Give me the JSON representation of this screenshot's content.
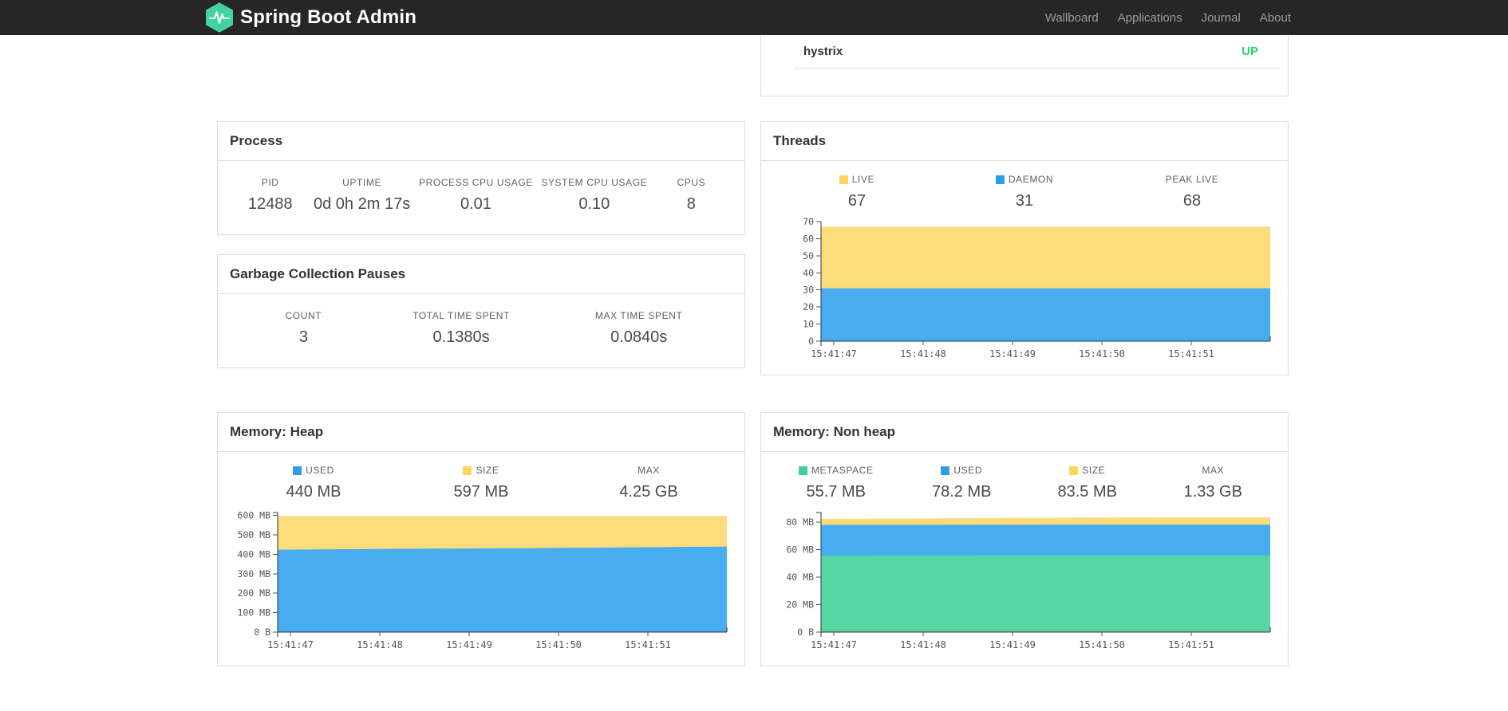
{
  "navbar": {
    "brand": "Spring Boot Admin",
    "links": [
      {
        "label": "Wallboard"
      },
      {
        "label": "Applications"
      },
      {
        "label": "Journal"
      },
      {
        "label": "About"
      }
    ],
    "colors": {
      "background": "#262626",
      "link": "#9d9d9d",
      "logo_green": "#42d3a5"
    }
  },
  "application_row": {
    "name": "hystrix",
    "status": "UP",
    "status_color": "#2bd46e"
  },
  "cards": {
    "process": {
      "title": "Process",
      "stats": [
        {
          "label": "PID",
          "value": "12488"
        },
        {
          "label": "UPTIME",
          "value": "0d 0h 2m 17s"
        },
        {
          "label": "PROCESS CPU USAGE",
          "value": "0.01"
        },
        {
          "label": "SYSTEM CPU USAGE",
          "value": "0.10"
        },
        {
          "label": "CPUS",
          "value": "8"
        }
      ]
    },
    "gc": {
      "title": "Garbage Collection Pauses",
      "stats": [
        {
          "label": "COUNT",
          "value": "3"
        },
        {
          "label": "TOTAL TIME SPENT",
          "value": "0.1380s"
        },
        {
          "label": "MAX TIME SPENT",
          "value": "0.0840s"
        }
      ]
    },
    "threads": {
      "title": "Threads",
      "stats": [
        {
          "label": "LIVE",
          "value": "67",
          "swatch": "#fcd45e"
        },
        {
          "label": "DAEMON",
          "value": "31",
          "swatch": "#2e9ee8"
        },
        {
          "label": "PEAK LIVE",
          "value": "68",
          "swatch": ""
        }
      ]
    },
    "heap": {
      "title": "Memory: Heap",
      "stats": [
        {
          "label": "USED",
          "value": "440 MB",
          "swatch": "#2e9ee8"
        },
        {
          "label": "SIZE",
          "value": "597 MB",
          "swatch": "#fcd45e"
        },
        {
          "label": "MAX",
          "value": "4.25 GB",
          "swatch": ""
        }
      ]
    },
    "nonheap": {
      "title": "Memory: Non heap",
      "stats": [
        {
          "label": "METASPACE",
          "value": "55.7 MB",
          "swatch": "#3fd1a1"
        },
        {
          "label": "USED",
          "value": "78.2 MB",
          "swatch": "#2e9ee8"
        },
        {
          "label": "SIZE",
          "value": "83.5 MB",
          "swatch": "#fcd45e"
        },
        {
          "label": "MAX",
          "value": "1.33 GB",
          "swatch": ""
        }
      ]
    }
  },
  "chart_data": [
    {
      "id": "threads",
      "type": "area",
      "title": "Threads",
      "x": [
        "15:41:47",
        "15:41:48",
        "15:41:49",
        "15:41:50",
        "15:41:51"
      ],
      "series": [
        {
          "name": "LIVE",
          "color": "#fddd7b",
          "values": [
            67,
            67,
            67,
            67,
            67
          ]
        },
        {
          "name": "DAEMON",
          "color": "#48acf0",
          "values": [
            31,
            31,
            31,
            31,
            31
          ]
        }
      ],
      "ylim": [
        0,
        70
      ],
      "yticks": [
        {
          "v": 0,
          "label": "0"
        },
        {
          "v": 10,
          "label": "10"
        },
        {
          "v": 20,
          "label": "20"
        },
        {
          "v": 30,
          "label": "30"
        },
        {
          "v": 40,
          "label": "40"
        },
        {
          "v": 50,
          "label": "50"
        },
        {
          "v": 60,
          "label": "60"
        },
        {
          "v": 70,
          "label": "70"
        }
      ],
      "grid": false,
      "legend_position": "top",
      "note": "layered absolute areas; LIVE drawn behind DAEMON"
    },
    {
      "id": "heap",
      "type": "area",
      "title": "Memory: Heap (MB)",
      "x": [
        "15:41:47",
        "15:41:48",
        "15:41:49",
        "15:41:50",
        "15:41:51"
      ],
      "series": [
        {
          "name": "SIZE",
          "color": "#fddd7b",
          "values": [
            597,
            597,
            597,
            597,
            597
          ]
        },
        {
          "name": "USED",
          "color": "#48acf0",
          "values": [
            424,
            428,
            431,
            435,
            440
          ]
        }
      ],
      "ylim": [
        0,
        615
      ],
      "yticks": [
        {
          "v": 0,
          "label": "0 B"
        },
        {
          "v": 100,
          "label": "100 MB"
        },
        {
          "v": 200,
          "label": "200 MB"
        },
        {
          "v": 300,
          "label": "300 MB"
        },
        {
          "v": 400,
          "label": "400 MB"
        },
        {
          "v": 500,
          "label": "500 MB"
        },
        {
          "v": 600,
          "label": "600 MB"
        }
      ],
      "grid": false,
      "legend_position": "top"
    },
    {
      "id": "nonheap",
      "type": "area",
      "title": "Memory: Non heap (MB)",
      "x": [
        "15:41:47",
        "15:41:48",
        "15:41:49",
        "15:41:50",
        "15:41:51"
      ],
      "series": [
        {
          "name": "SIZE",
          "color": "#fddd7b",
          "values": [
            82.4,
            82.8,
            83.2,
            83.5,
            83.5
          ]
        },
        {
          "name": "USED",
          "color": "#48acf0",
          "values": [
            78.0,
            78.0,
            78.1,
            78.2,
            78.2
          ]
        },
        {
          "name": "METASPACE",
          "color": "#55d6a3",
          "values": [
            55.5,
            55.6,
            55.7,
            55.7,
            55.7
          ]
        }
      ],
      "ylim": [
        0,
        87
      ],
      "yticks": [
        {
          "v": 0,
          "label": "0 B"
        },
        {
          "v": 20,
          "label": "20 MB"
        },
        {
          "v": 40,
          "label": "40 MB"
        },
        {
          "v": 60,
          "label": "60 MB"
        },
        {
          "v": 80,
          "label": "80 MB"
        }
      ],
      "grid": false,
      "legend_position": "top"
    }
  ]
}
